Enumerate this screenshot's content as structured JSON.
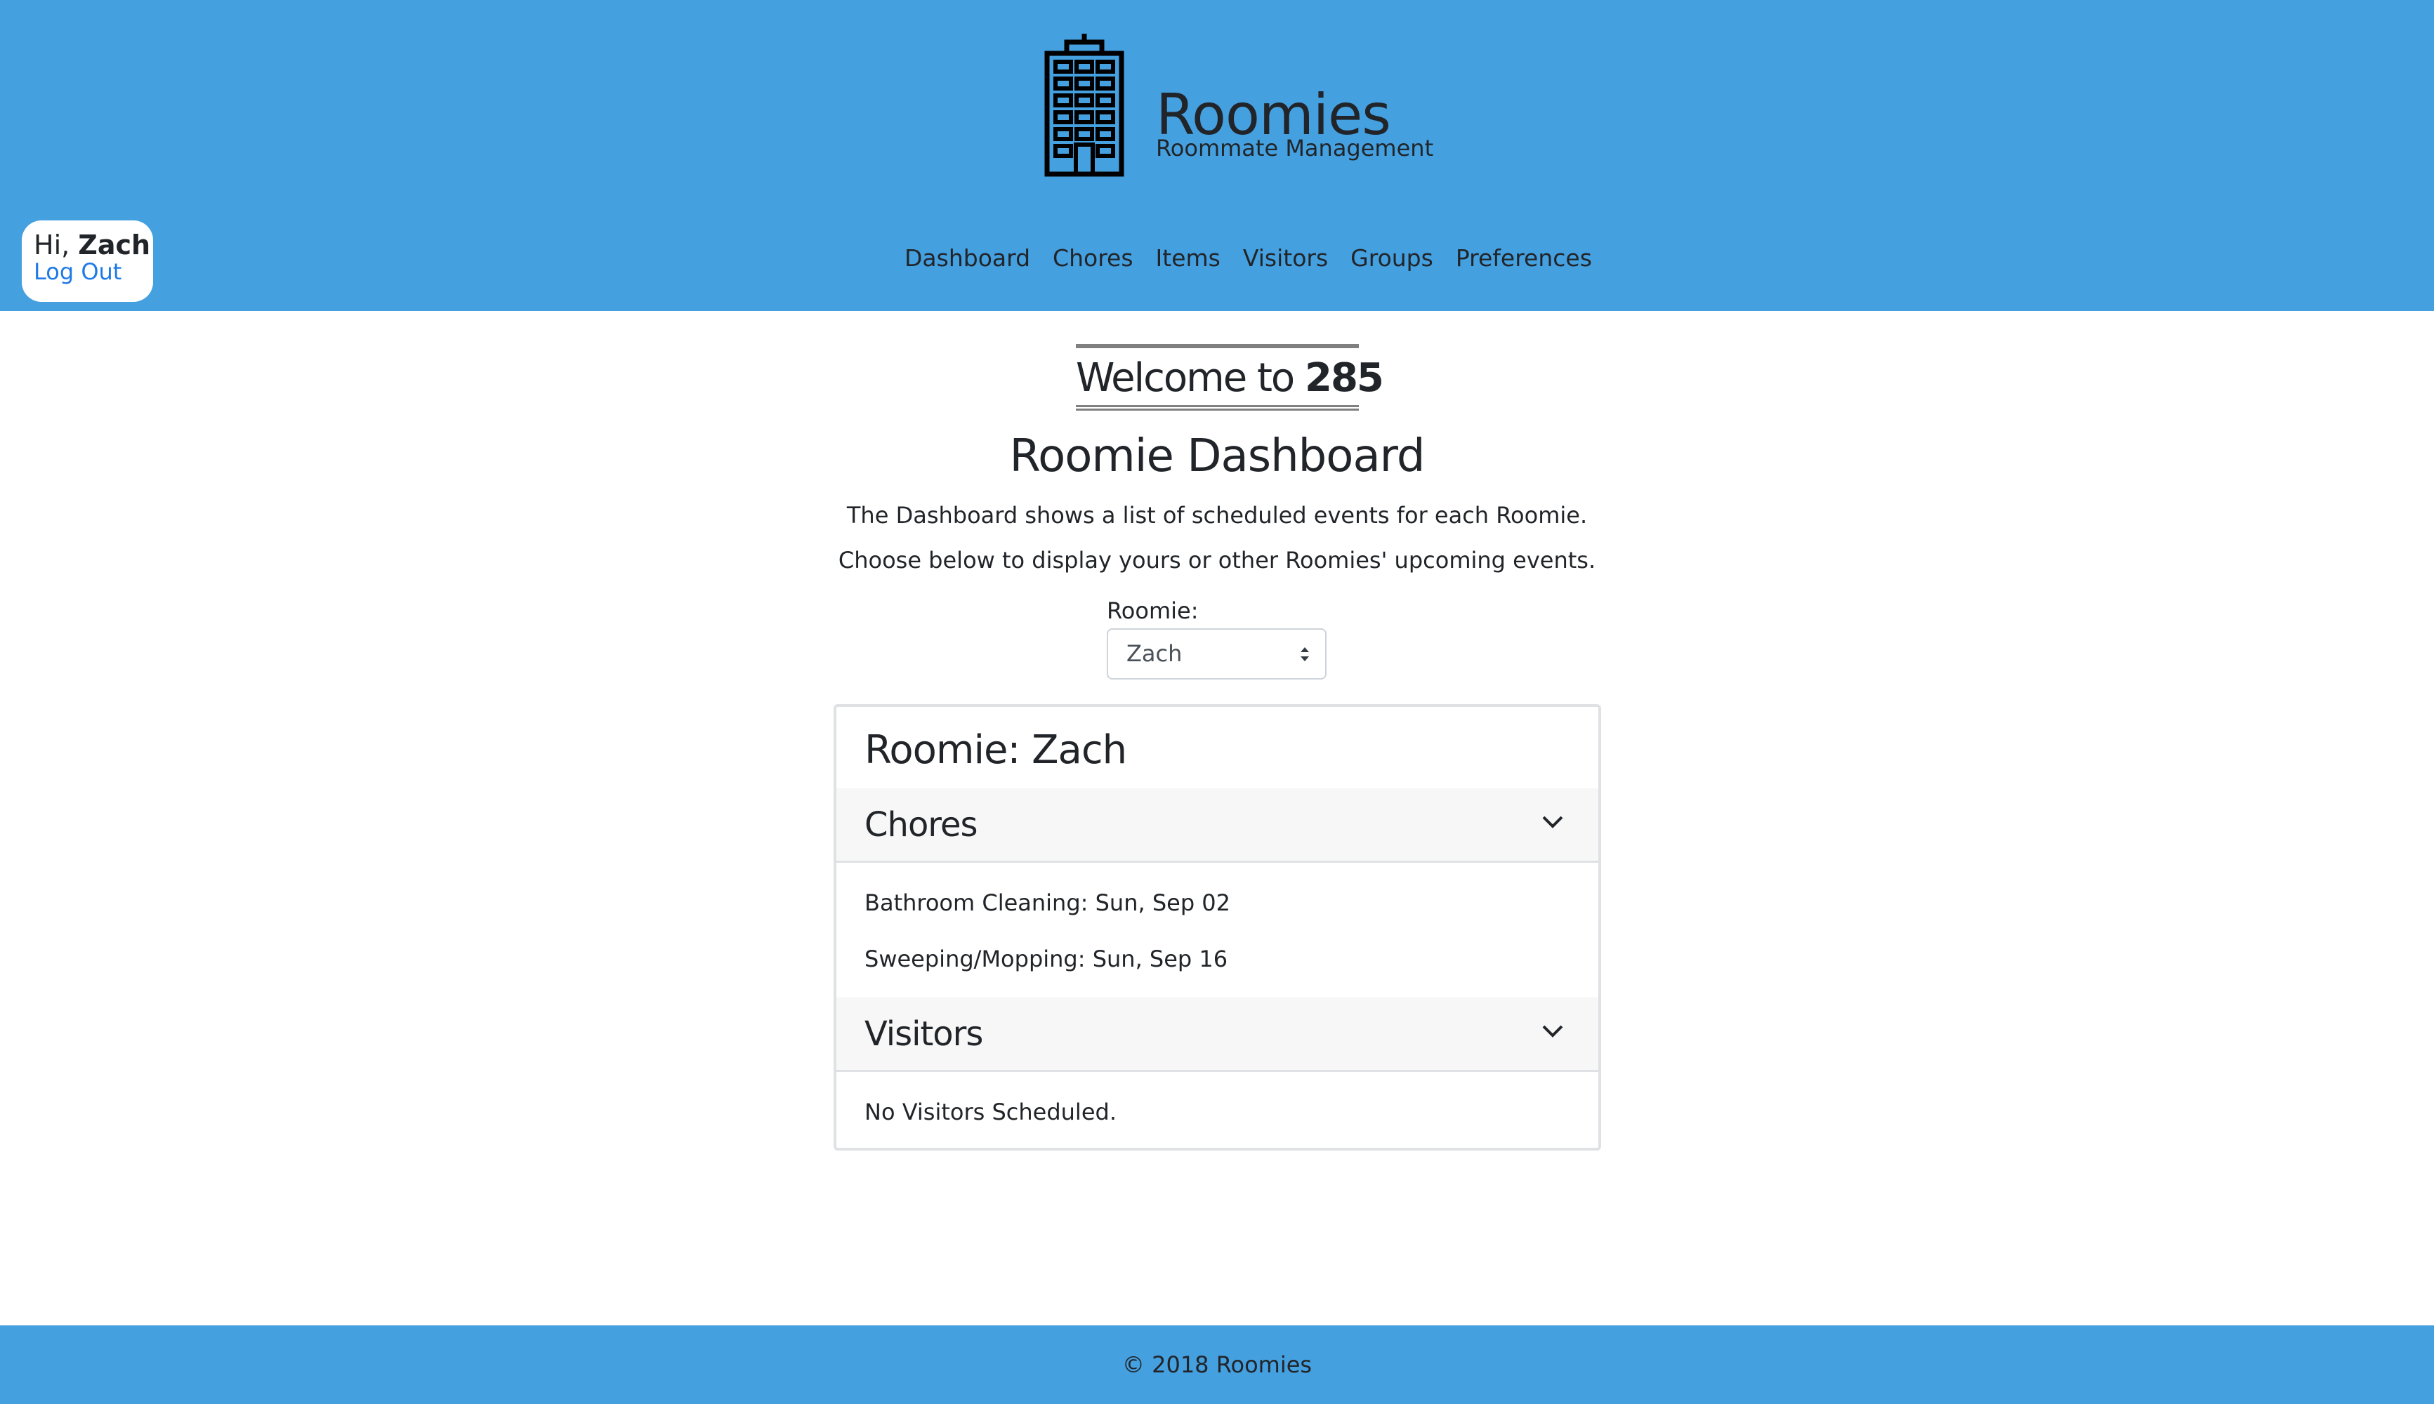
{
  "header": {
    "logo_icon": "building-icon",
    "brand_title": "Roomies",
    "brand_subtitle": "Roommate Management",
    "background_color": "#45a0e0"
  },
  "user": {
    "greeting_prefix": "Hi, ",
    "name": "Zach",
    "logout_label": "Log Out",
    "logout_color": "#1f79e6"
  },
  "nav": {
    "items": [
      {
        "label": "Dashboard"
      },
      {
        "label": "Chores"
      },
      {
        "label": "Items"
      },
      {
        "label": "Visitors"
      },
      {
        "label": "Groups"
      },
      {
        "label": "Preferences"
      }
    ]
  },
  "main": {
    "welcome_prefix": "Welcome to",
    "welcome_number": "285",
    "title": "Roomie Dashboard",
    "description_1": "The Dashboard shows a list of scheduled events for each Roomie.",
    "description_2": "Choose below to display yours or other Roomies' upcoming events.",
    "roomie_label": "Roomie:",
    "roomie_selected": "Zach"
  },
  "card": {
    "title": "Roomie: Zach",
    "chores": {
      "title": "Chores",
      "items": [
        "Bathroom Cleaning: Sun, Sep 02",
        "Sweeping/Mopping: Sun, Sep 16"
      ]
    },
    "visitors": {
      "title": "Visitors",
      "empty_text": "No Visitors Scheduled."
    }
  },
  "footer": {
    "text": "© 2018 Roomies"
  }
}
